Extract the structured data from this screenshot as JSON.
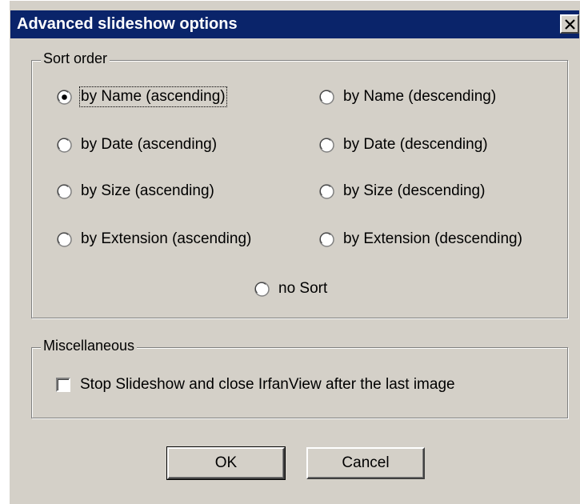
{
  "window": {
    "title": "Advanced slideshow options"
  },
  "sort_order": {
    "legend": "Sort order",
    "options": [
      {
        "label": "by Name (ascending)",
        "selected": true
      },
      {
        "label": "by Name (descending)",
        "selected": false
      },
      {
        "label": "by Date (ascending)",
        "selected": false
      },
      {
        "label": "by Date (descending)",
        "selected": false
      },
      {
        "label": "by Size (ascending)",
        "selected": false
      },
      {
        "label": "by Size (descending)",
        "selected": false
      },
      {
        "label": "by Extension (ascending)",
        "selected": false
      },
      {
        "label": "by Extension (descending)",
        "selected": false
      },
      {
        "label": "no Sort",
        "selected": false
      }
    ]
  },
  "misc": {
    "legend": "Miscellaneous",
    "stop_slideshow": {
      "label": "Stop Slideshow and close IrfanView after the last image",
      "checked": false
    }
  },
  "buttons": {
    "ok": "OK",
    "cancel": "Cancel"
  },
  "colors": {
    "titlebar": "#0a246a",
    "face": "#d4d0c8"
  }
}
